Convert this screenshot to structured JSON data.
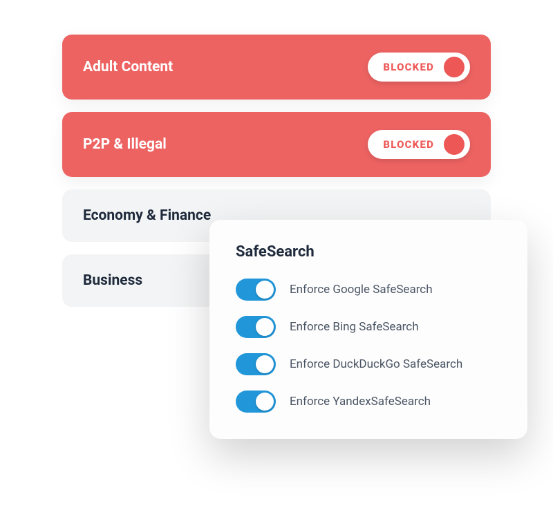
{
  "categories": [
    {
      "label": "Adult Content",
      "blocked": true,
      "status": "BLOCKED"
    },
    {
      "label": "P2P & Illegal",
      "blocked": true,
      "status": "BLOCKED"
    },
    {
      "label": "Economy & Finance",
      "blocked": false
    },
    {
      "label": "Business",
      "blocked": false
    }
  ],
  "safesearch": {
    "title": "SafeSearch",
    "items": [
      {
        "label": "Enforce Google SafeSearch",
        "enabled": true
      },
      {
        "label": "Enforce Bing SafeSearch",
        "enabled": true
      },
      {
        "label": "Enforce DuckDuckGo SafeSearch",
        "enabled": true
      },
      {
        "label": "Enforce YandexSafeSearch",
        "enabled": true
      }
    ]
  },
  "colors": {
    "blocked_bg": "#ed6362",
    "blocked_accent": "#ed5857",
    "allowed_bg": "#f3f4f5",
    "switch_on": "#2196d9",
    "text_dark": "#1e2a3b",
    "text_muted": "#4a5564"
  }
}
